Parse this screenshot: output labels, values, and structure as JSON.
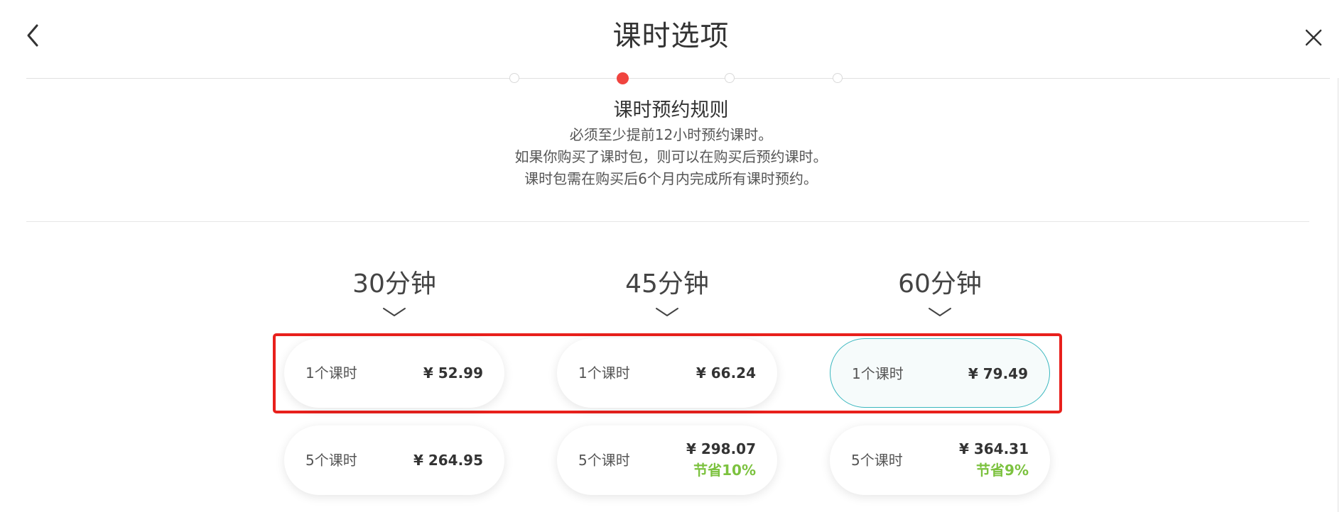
{
  "header": {
    "title": "课时选项",
    "back_icon": "chevron-left-icon",
    "close_icon": "close-icon"
  },
  "stepper": {
    "total_steps": 4,
    "active_step": 2
  },
  "rules": {
    "title": "课时预约规则",
    "lines": [
      "必须至少提前12小时预约课时。",
      "如果你购买了课时包，则可以在购买后预约课时。",
      "课时包需在购买后6个月内完成所有课时预约。"
    ]
  },
  "durations": [
    {
      "label": "30分钟",
      "options": [
        {
          "label": "1个课时",
          "price": "¥ 52.99",
          "savings": ""
        },
        {
          "label": "5个课时",
          "price": "¥ 264.95",
          "savings": ""
        }
      ]
    },
    {
      "label": "45分钟",
      "options": [
        {
          "label": "1个课时",
          "price": "¥ 66.24",
          "savings": ""
        },
        {
          "label": "5个课时",
          "price": "¥ 298.07",
          "savings": "节省10%"
        }
      ]
    },
    {
      "label": "60分钟",
      "options": [
        {
          "label": "1个课时",
          "price": "¥ 79.49",
          "savings": "",
          "selected": true
        },
        {
          "label": "5个课时",
          "price": "¥ 364.31",
          "savings": "节省9%"
        }
      ]
    }
  ],
  "colors": {
    "active_step": "#f0443f",
    "selected_border": "#3ab7bf",
    "selected_bg": "#f6fbfb",
    "savings_text": "#7cc23f",
    "highlight_border": "#e8201c"
  }
}
